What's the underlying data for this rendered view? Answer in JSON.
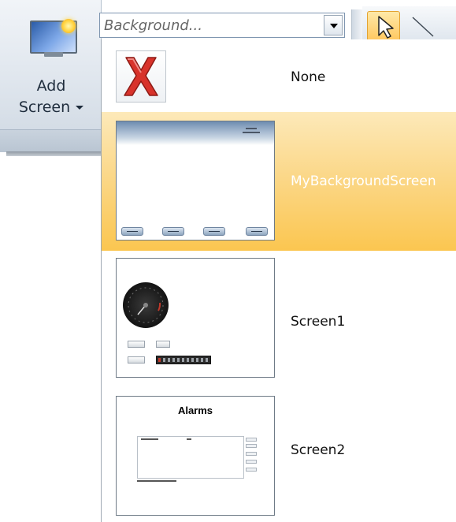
{
  "ribbon": {
    "add_screen": {
      "label_line1": "Add",
      "label_line2": "Screen",
      "icon": "monitor-sun-icon"
    }
  },
  "background_combo": {
    "placeholder": "Background...",
    "value": "",
    "dropdown_icon": "chevron-down-icon"
  },
  "toolbar": {
    "pointer_tool_icon": "pointer-arrow-icon",
    "line_tool_icon": "line-tool-icon",
    "active_color": "#ffc860"
  },
  "dropdown": {
    "selected_index": 1,
    "items": [
      {
        "label": "None",
        "icon": "red-x-icon"
      },
      {
        "label": "MyBackgroundScreen",
        "icon": "background-screen-thumbnail"
      },
      {
        "label": "Screen1",
        "icon": "screen1-thumbnail"
      },
      {
        "label": "Screen2",
        "icon": "screen2-thumbnail",
        "thumb_title": "Alarms"
      }
    ]
  },
  "colors": {
    "selection_highlight": "#fbc650",
    "ribbon_background": "#dde4ec",
    "none_icon_red": "#d8332b"
  }
}
